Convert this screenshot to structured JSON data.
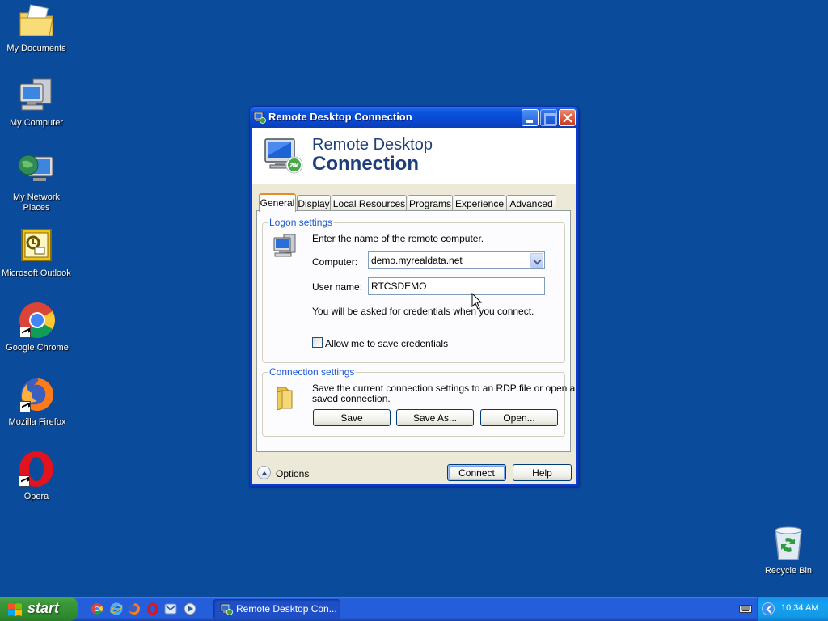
{
  "desktop": {
    "icons": [
      {
        "label": "My Documents",
        "icon": "folder-documents-icon"
      },
      {
        "label": "My Computer",
        "icon": "computer-icon"
      },
      {
        "label": "My Network Places",
        "icon": "network-places-icon"
      },
      {
        "label": "Microsoft Outlook",
        "icon": "outlook-icon"
      },
      {
        "label": "Google Chrome",
        "icon": "chrome-icon"
      },
      {
        "label": "Mozilla Firefox",
        "icon": "firefox-icon"
      },
      {
        "label": "Opera",
        "icon": "opera-icon"
      },
      {
        "label": "Recycle Bin",
        "icon": "recycle-bin-icon"
      }
    ]
  },
  "window": {
    "title": "Remote Desktop Connection",
    "banner_line1": "Remote Desktop",
    "banner_line2": "Connection",
    "tabs": [
      {
        "label": "General",
        "active": true
      },
      {
        "label": "Display"
      },
      {
        "label": "Local Resources"
      },
      {
        "label": "Programs"
      },
      {
        "label": "Experience"
      },
      {
        "label": "Advanced"
      }
    ],
    "logon": {
      "title": "Logon settings",
      "instruction": "Enter the name of the remote computer.",
      "computer_label": "Computer:",
      "computer_value": "demo.myrealdata.net",
      "username_label": "User name:",
      "username_value": "RTCSDEMO",
      "credentials_note": "You will be asked for credentials when you connect.",
      "save_credentials_label": "Allow me to save credentials",
      "save_credentials_checked": false
    },
    "connection": {
      "title": "Connection settings",
      "description_line1": "Save the current connection settings to an RDP file or open a",
      "description_line2": "saved connection.",
      "save_label": "Save",
      "save_as_label": "Save As...",
      "open_label": "Open..."
    },
    "footer": {
      "options_label": "Options",
      "connect_label": "Connect",
      "help_label": "Help"
    }
  },
  "taskbar": {
    "start_label": "start",
    "quick_launch": [
      "chrome-icon",
      "ie-icon",
      "firefox-icon",
      "opera-icon",
      "outlook-icon",
      "media-player-icon"
    ],
    "task_label": "Remote Desktop Con...",
    "clock": "10:34 AM"
  },
  "colors": {
    "desktop": "#0b4b9c",
    "title_bar": "#0a53dc",
    "group_title": "#1d5ad8",
    "banner_text": "#1f3f7a"
  }
}
